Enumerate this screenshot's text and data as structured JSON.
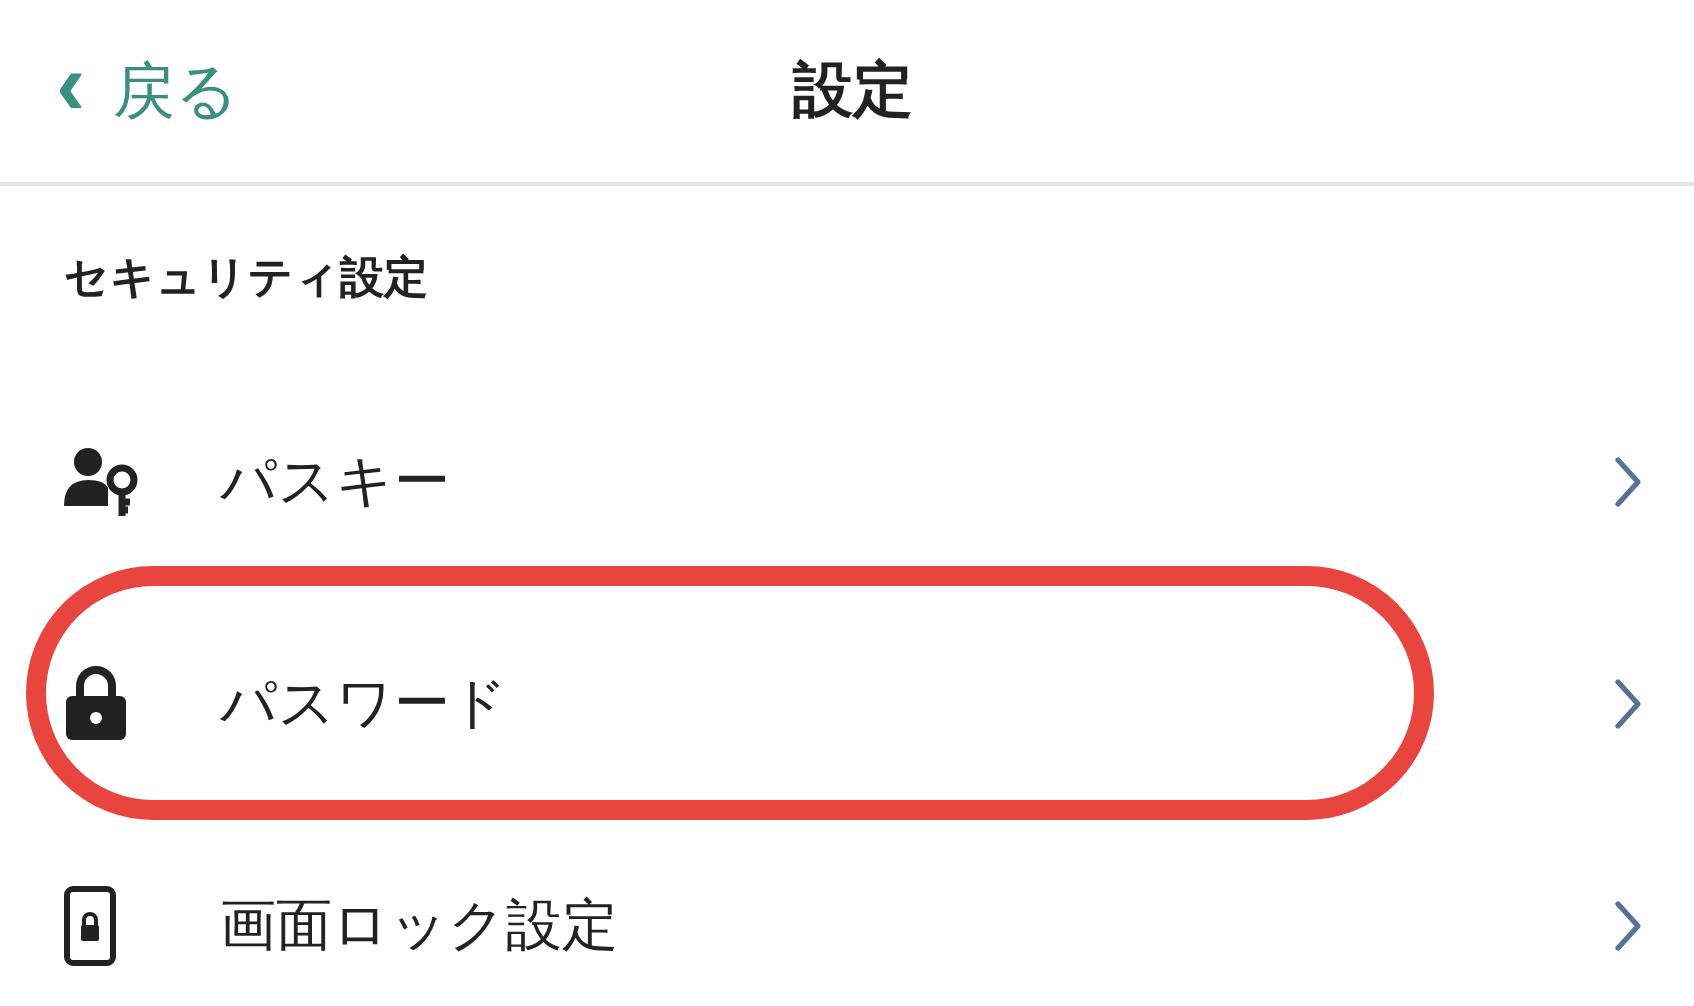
{
  "header": {
    "back_icon": "‹",
    "back_label": "戻る",
    "title": "設定"
  },
  "section": {
    "heading": "セキュリティ設定"
  },
  "items": [
    {
      "kind": "passkey",
      "label": "パスキー",
      "highlighted": false
    },
    {
      "kind": "password",
      "label": "パスワード",
      "highlighted": true
    },
    {
      "kind": "screen-lock",
      "label": "画面ロック設定",
      "highlighted": false
    }
  ]
}
